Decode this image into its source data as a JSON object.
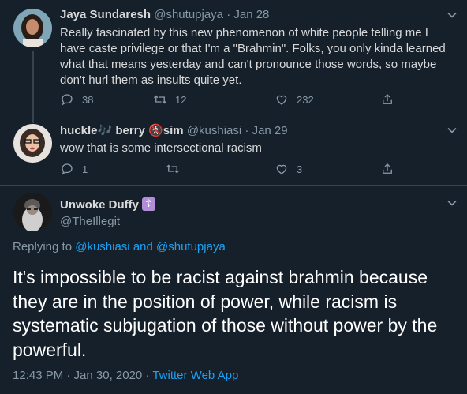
{
  "tweets": [
    {
      "display_name": "Jaya Sundaresh",
      "handle": "@shutupjaya",
      "date": "Jan 28",
      "text": "Really fascinated by this new phenomenon of white people telling me I have caste privilege or that I'm a \"Brahmin\". Folks, you only kinda learned what that means yesterday and can't pronounce those words, so maybe don't hurl them as insults quite yet.",
      "replies": "38",
      "retweets": "12",
      "likes": "232"
    },
    {
      "display_name_part1": "huckle",
      "display_name_part2": "berry",
      "display_name_part3": "sim",
      "emoji_1": "🎶",
      "emoji_2": "🚷",
      "handle": "@kushiasi",
      "date": "Jan 29",
      "text": "wow that is some intersectional racism",
      "replies": "1",
      "retweets": "",
      "likes": "3"
    }
  ],
  "main_tweet": {
    "display_name": "Unwoke Duffy",
    "handle": "@TheIllegit",
    "badge_glyph": "☦",
    "replying_to_prefix": "Replying to",
    "replying_to_user1": "@kushiasi",
    "replying_to_and": "and",
    "replying_to_user2": "@shutupjaya",
    "text": "It's impossible to be racist against brahmin because they are in the position of power, while racism is systematic subjugation of those without power by the powerful.",
    "time": "12:43 PM · Jan 30, 2020 · ",
    "source": "Twitter Web App"
  },
  "colors": {
    "background": "#15202b",
    "muted": "#8899a6",
    "link": "#1da1f2",
    "badge": "#b28dd8"
  },
  "icons": [
    "reply-icon",
    "retweet-icon",
    "like-icon",
    "share-icon",
    "chevron-down-icon"
  ]
}
